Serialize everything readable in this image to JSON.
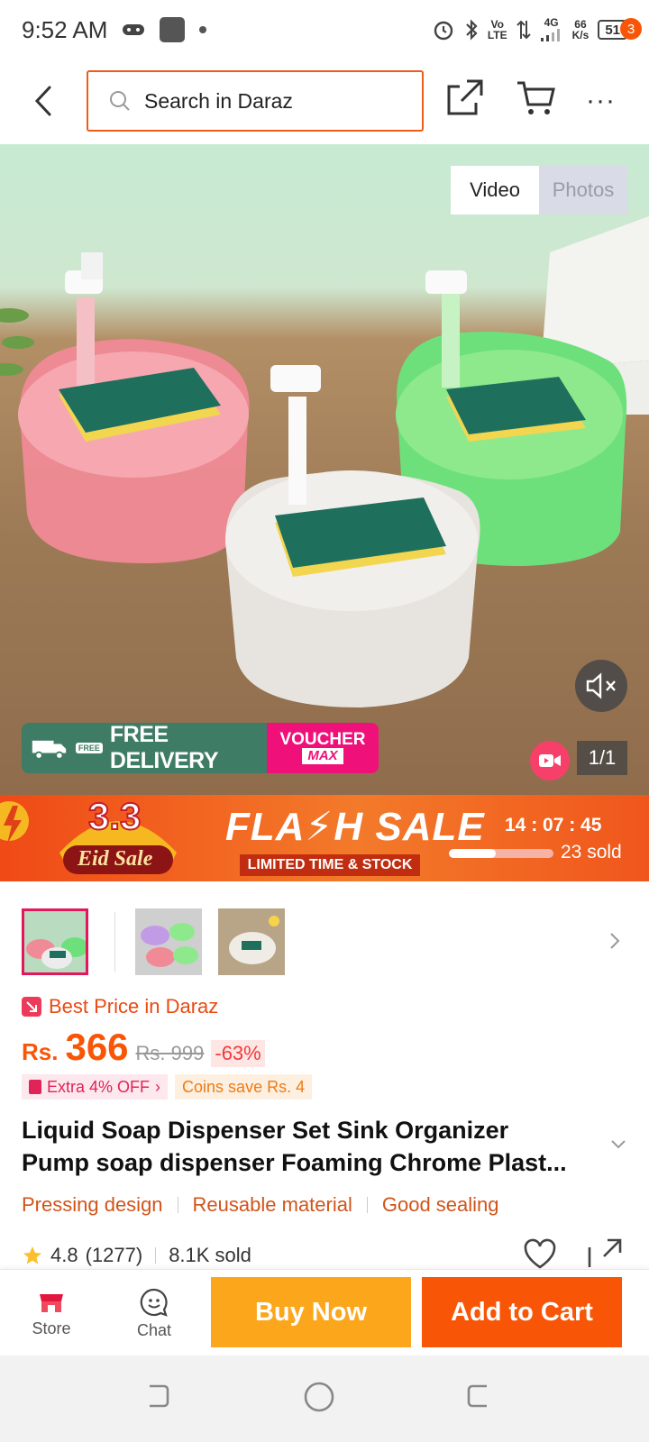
{
  "status_bar": {
    "time": "9:52 AM",
    "network_top": "Vo",
    "network_bottom": "LTE",
    "signal_label": "4G",
    "speed_value": "66",
    "speed_unit": "K/s",
    "battery": "51"
  },
  "header": {
    "search_placeholder": "Search in Daraz",
    "cart_badge": "3"
  },
  "media": {
    "tabs": [
      {
        "label": "Video",
        "active": true
      },
      {
        "label": "Photos",
        "active": false
      }
    ],
    "delivery_tag": "FREE",
    "delivery_text": "FREE DELIVERY",
    "voucher_text": "VOUCHER",
    "voucher_sub": "MAX",
    "counter": "1/1"
  },
  "flash_sale": {
    "eid_number": "3.3",
    "eid_label": "Eid Sale",
    "title": "FLA⚡H SALE",
    "subtitle": "LIMITED TIME & STOCK",
    "countdown": "14 : 07 : 45",
    "sold_text": "23 sold",
    "progress_fraction": 0.45
  },
  "price": {
    "badge_text": "Best Price in Daraz",
    "currency": "Rs.",
    "value": "366",
    "old_price": "Rs. 999",
    "discount": "-63%",
    "promo_extra": "Extra 4% OFF",
    "promo_coins": "Coins save Rs. 4"
  },
  "product": {
    "title_line1": "Liquid Soap Dispenser Set Sink Organizer",
    "title_line2": "Pump soap dispenser Foaming Chrome Plast...",
    "features": [
      "Pressing design",
      "Reusable material",
      "Good sealing"
    ],
    "rating": "4.8",
    "reviews": "(1277)",
    "sold": "8.1K sold"
  },
  "bottom_bar": {
    "store_label": "Store",
    "chat_label": "Chat",
    "buy_now": "Buy Now",
    "add_to_cart": "Add to Cart"
  },
  "colors": {
    "brand_orange": "#f85606",
    "buy_now_yellow": "#fca61c",
    "accent_pink": "#e3175a"
  }
}
